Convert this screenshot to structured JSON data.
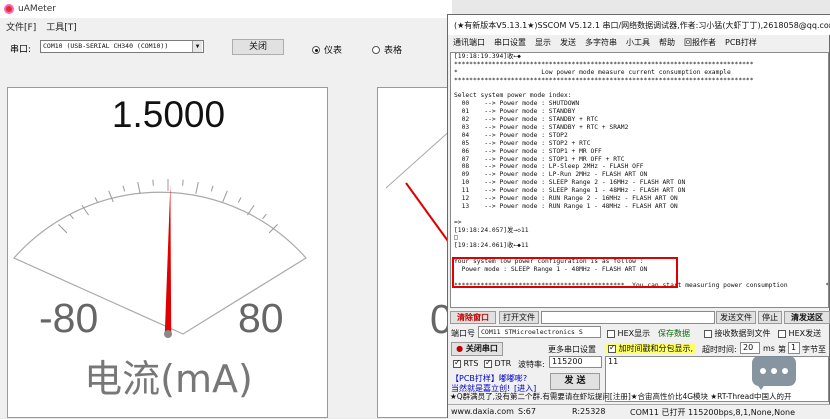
{
  "uameter": {
    "title": "uAMeter",
    "menu": [
      "文件[F]",
      "工具[T]"
    ],
    "port_label": "串口:",
    "port_value": "COM10 (USB-SERIAL CH340 (COM10))",
    "close_button": "关闭",
    "mode_meter": "仪表",
    "mode_table": "表格",
    "reading": "1.5000",
    "scale_min": "-80",
    "scale_max": "80",
    "unit_label": "电流(mA)",
    "needle_fraction": 0.51,
    "second_panel_fragment": "0"
  },
  "sscom": {
    "title": "(★有新版本V5.13.1★)SSCOM V5.12.1 串口/网络数据调试器,作者:习小猛(大虾丁丁),2618058@qq.com",
    "menu": [
      "通讯端口",
      "串口设置",
      "显示",
      "发送",
      "多字符串",
      "小工具",
      "帮助",
      "回报作者",
      "PCB打样"
    ],
    "console_lines": [
      "[19:18:19.394]收←◆",
      "*******************************************************************************",
      "*                      Low power mode measure current consumption example",
      "*******************************************************************************",
      "",
      "Select system power mode index:",
      "  00    --> Power mode : SHUTDOWN",
      "  01    --> Power mode : STANDBY",
      "  02    --> Power mode : STANDBY + RTC",
      "  03    --> Power mode : STANDBY + RTC + SRAM2",
      "  04    --> Power mode : STOP2",
      "  05    --> Power mode : STOP2 + RTC",
      "  06    --> Power mode : STOP1 + MR OFF",
      "  07    --> Power mode : STOP1 + MR OFF + RTC",
      "  08    --> Power mode : LP-Sleep 2MHz - FLASH OFF",
      "  09    --> Power mode : LP-Run 2MHz - FLASH ART ON",
      "  10    --> Power mode : SLEEP Range 2 - 16MHz - FLASH ART ON",
      "  11    --> Power mode : SLEEP Range 1 - 48MHz - FLASH ART ON",
      "  12    --> Power mode : RUN Range 2 - 16MHz - FLASH ART ON",
      "  13    --> Power mode : RUN Range 1 - 48MHz - FLASH ART ON",
      "",
      "=>",
      "[19:18:24.057]发→◇11",
      "□",
      "[19:18:24.061]收←◆11",
      "",
      "Your system low power configuration is as follow :",
      "  Power mode : SLEEP Range 1 - 48MHz - FLASH ART ON",
      "",
      "*********************************************  You can start measuring power consumption          *"
    ],
    "clear_window": "清除窗口",
    "open_file": "打开文件",
    "send_file": "发送文件",
    "stop": "停止",
    "clear_send": "清发送区",
    "port_label": "端口号",
    "port_value": "COM11 STMicroelectronics S",
    "hex_display": "HEX显示",
    "save_data": "保存数据",
    "recv_to_file": "接收数据到文件",
    "hex_send": "HEX发送",
    "close_port": "关闭串口",
    "more_ports": "更多串口设置",
    "timestamp_label": "加时间戳和分包显示,",
    "timeout_label": "超时时间:",
    "timeout_value": "20",
    "timeout_unit": "ms",
    "nth_label": "第",
    "nth_value": "1",
    "nth_unit": "字节至",
    "rts": "RTS",
    "dtr": "DTR",
    "baud_label": "波特率:",
    "baud_value": "115200",
    "send_text": "11",
    "promo_line1": "【PCB打样】嘟嘟嘭?",
    "promo_line2": "当然就是嘉立创!",
    "promo_link": "[进入]",
    "send_button": "发 送",
    "ticker": "★Q群满员了,没有第二个群.有需要请在虾坛提问[注册]★合宙高性价比4G模块 ★RT-Thread中国人的开",
    "status_url": "www.daxia.com",
    "status_s": "S:67",
    "status_r": "R:25328",
    "status_port": "COM11 已打开  115200bps,8,1,None,None"
  },
  "chat_icon": "chat-bubble-icon"
}
